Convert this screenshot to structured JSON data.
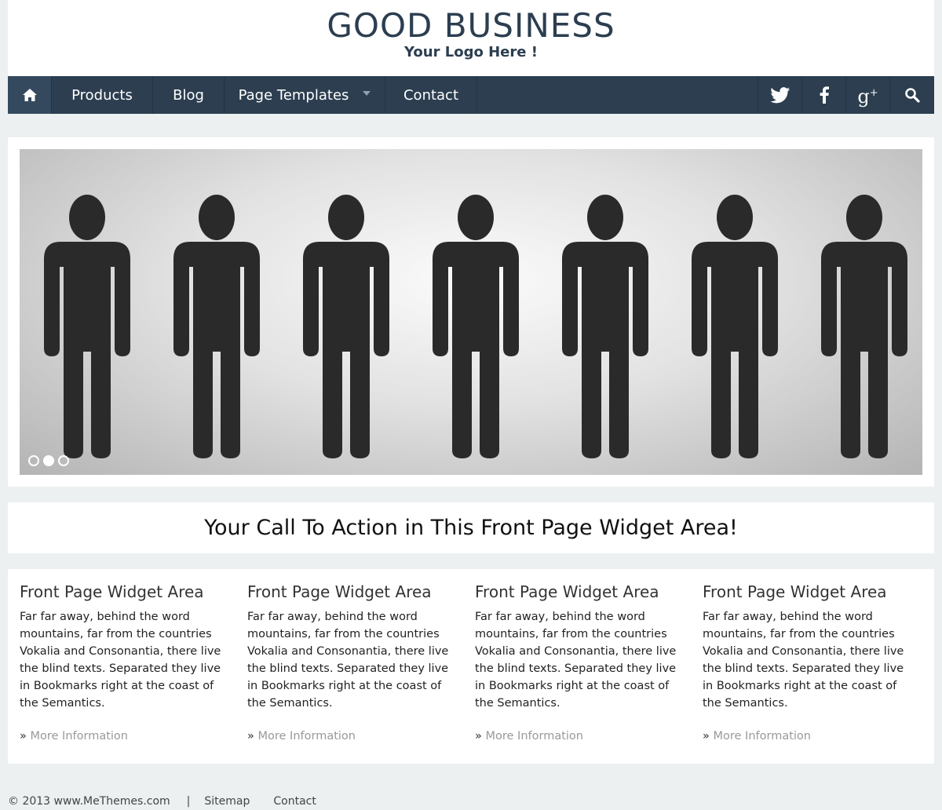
{
  "header": {
    "title": "GOOD BUSINESS",
    "tagline": "Your Logo Here !"
  },
  "nav": {
    "items": [
      {
        "label": "Products"
      },
      {
        "label": "Blog"
      },
      {
        "label": "Page Templates"
      },
      {
        "label": "Contact"
      }
    ],
    "icons": [
      "home-icon",
      "twitter-icon",
      "facebook-icon",
      "google-plus-icon",
      "search-icon"
    ],
    "color": "#2c3e50"
  },
  "slider": {
    "active_slide": 2,
    "slide_count": 3
  },
  "cta": {
    "text": "Your Call To Action in This Front Page Widget Area!"
  },
  "widgets": [
    {
      "title": "Front Page Widget Area",
      "body": "Far far away, behind the word mountains, far from the countries Vokalia and Consonantia, there live the blind texts. Separated they live in Bookmarks right at the coast of the Semantics.",
      "link_prefix": "»",
      "link": "More Information"
    },
    {
      "title": "Front Page Widget Area",
      "body": "Far far away, behind the word mountains, far from the countries Vokalia and Consonantia, there live the blind texts. Separated they live in Bookmarks right at the coast of the Semantics.",
      "link_prefix": "»",
      "link": "More Information"
    },
    {
      "title": "Front Page Widget Area",
      "body": "Far far away, behind the word mountains, far from the countries Vokalia and Consonantia, there live the blind texts. Separated they live in Bookmarks right at the coast of the Semantics.",
      "link_prefix": "»",
      "link": "More Information"
    },
    {
      "title": "Front Page Widget Area",
      "body": "Far far away, behind the word mountains, far from the countries Vokalia and Consonantia, there live the blind texts. Separated they live in Bookmarks right at the coast of the Semantics.",
      "link_prefix": "»",
      "link": "More Information"
    }
  ],
  "footer": {
    "copyright": "© 2013 www.MeThemes.com",
    "separator": "|",
    "links": [
      "Sitemap",
      "Contact"
    ]
  }
}
